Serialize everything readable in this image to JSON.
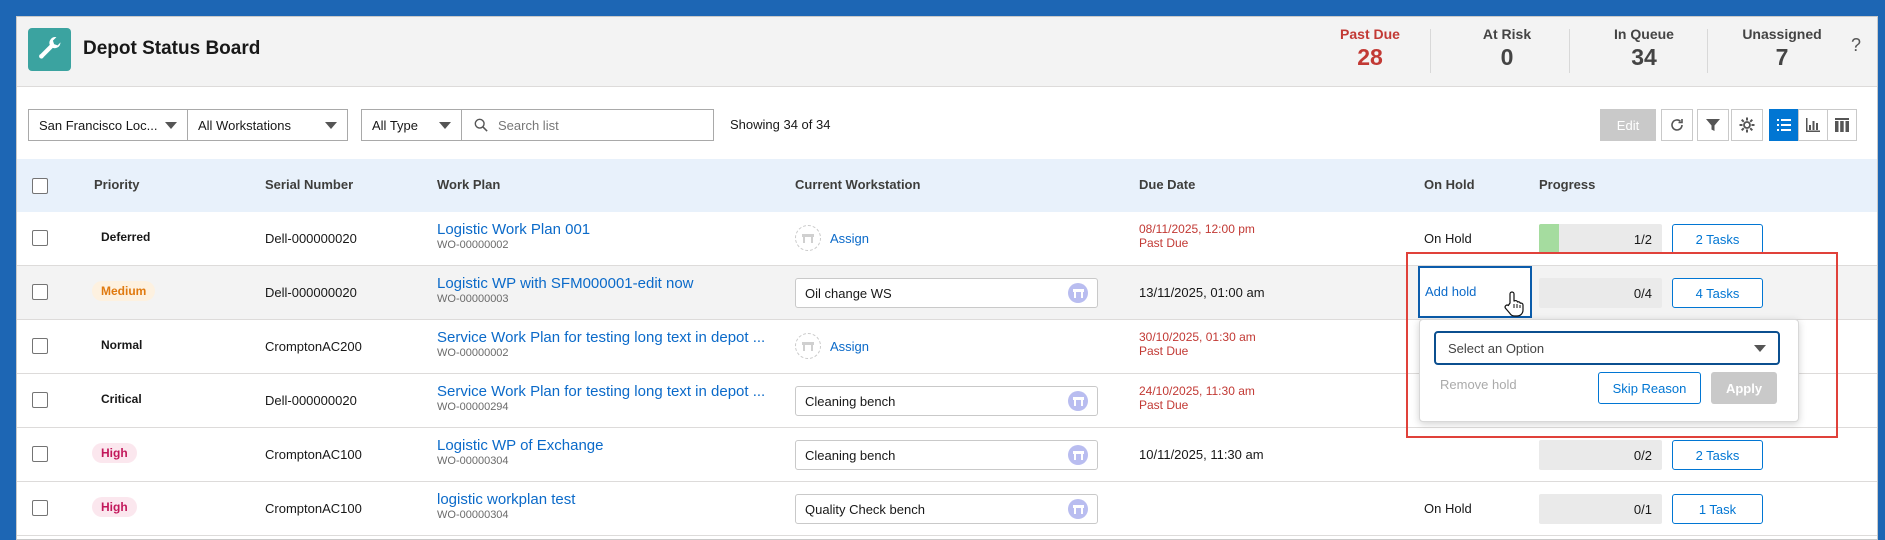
{
  "app": {
    "title": "Depot Status Board",
    "icon": "wrench-icon"
  },
  "stats": [
    {
      "label": "Past Due",
      "value": "28",
      "color": "#c23934"
    },
    {
      "label": "At Risk",
      "value": "0"
    },
    {
      "label": "In Queue",
      "value": "34"
    },
    {
      "label": "Unassigned",
      "value": "7"
    }
  ],
  "help": "?",
  "toolbar": {
    "location": "San Francisco Loc...",
    "workstations": "All Workstations",
    "type": "All Type",
    "search_placeholder": "Search list",
    "showing": "Showing 34 of 34",
    "edit_label": "Edit"
  },
  "columns": {
    "priority": "Priority",
    "serial": "Serial Number",
    "work_plan": "Work Plan",
    "workstation": "Current Workstation",
    "due_date": "Due Date",
    "on_hold": "On Hold",
    "progress": "Progress"
  },
  "rows": [
    {
      "priority": "Deferred",
      "serial": "Dell-000000020",
      "plan": "Logistic Work Plan 001",
      "wo": "WO-00000002",
      "workstation": "",
      "assign": "Assign",
      "due": "08/11/2025, 12:00 pm",
      "past_due": "Past Due",
      "on_hold": "On Hold",
      "progress": "1/2",
      "progress_frac": 0.5,
      "tasks": "2 Tasks"
    },
    {
      "priority": "Medium",
      "serial": "Dell-000000020",
      "plan": "Logistic WP with SFM000001-edit now",
      "wo": "WO-00000003",
      "workstation": "Oil change WS",
      "due": "13/11/2025, 01:00 am",
      "on_hold": "Add hold",
      "progress": "0/4",
      "progress_frac": 0,
      "tasks": "4 Tasks"
    },
    {
      "priority": "Normal",
      "serial": "CromptonAC200",
      "plan": "Service Work Plan for testing long text in depot ...",
      "wo": "WO-00000002",
      "workstation": "",
      "assign": "Assign",
      "due": "30/10/2025, 01:30 am",
      "past_due": "Past Due"
    },
    {
      "priority": "Critical",
      "serial": "Dell-000000020",
      "plan": "Service Work Plan for testing long text in depot ...",
      "wo": "WO-00000294",
      "workstation": "Cleaning bench",
      "due": "24/10/2025, 11:30 am",
      "past_due": "Past Due"
    },
    {
      "priority": "High",
      "serial": "CromptonAC100",
      "plan": "Logistic WP of Exchange",
      "wo": "WO-00000304",
      "workstation": "Cleaning bench",
      "due": "10/11/2025, 11:30 am",
      "progress": "0/2",
      "progress_frac": 0,
      "tasks": "2 Tasks"
    },
    {
      "priority": "High",
      "serial": "CromptonAC100",
      "plan": "logistic workplan test",
      "wo": "WO-00000304",
      "workstation": "Quality Check bench",
      "due": "",
      "on_hold": "On Hold",
      "progress": "0/1",
      "progress_frac": 0,
      "tasks": "1 Task"
    }
  ],
  "hold_popover": {
    "select_placeholder": "Select an Option",
    "remove_label": "Remove hold",
    "skip_label": "Skip Reason",
    "apply_label": "Apply"
  }
}
